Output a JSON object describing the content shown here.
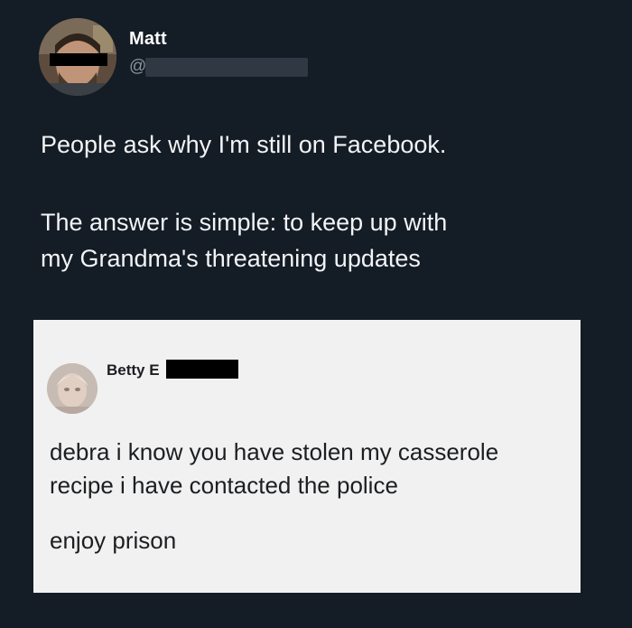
{
  "tweet": {
    "author": {
      "display_name": "Matt",
      "handle": "@"
    },
    "text_lines": [
      "People ask why I'm still on Facebook.",
      "The answer is simple: to keep up with",
      "my Grandma's threatening updates"
    ]
  },
  "facebook_post": {
    "author_name": "Betty E",
    "text_lines": [
      "debra i know you have stolen my casserole",
      "recipe i have contacted the police",
      "enjoy prison"
    ]
  }
}
